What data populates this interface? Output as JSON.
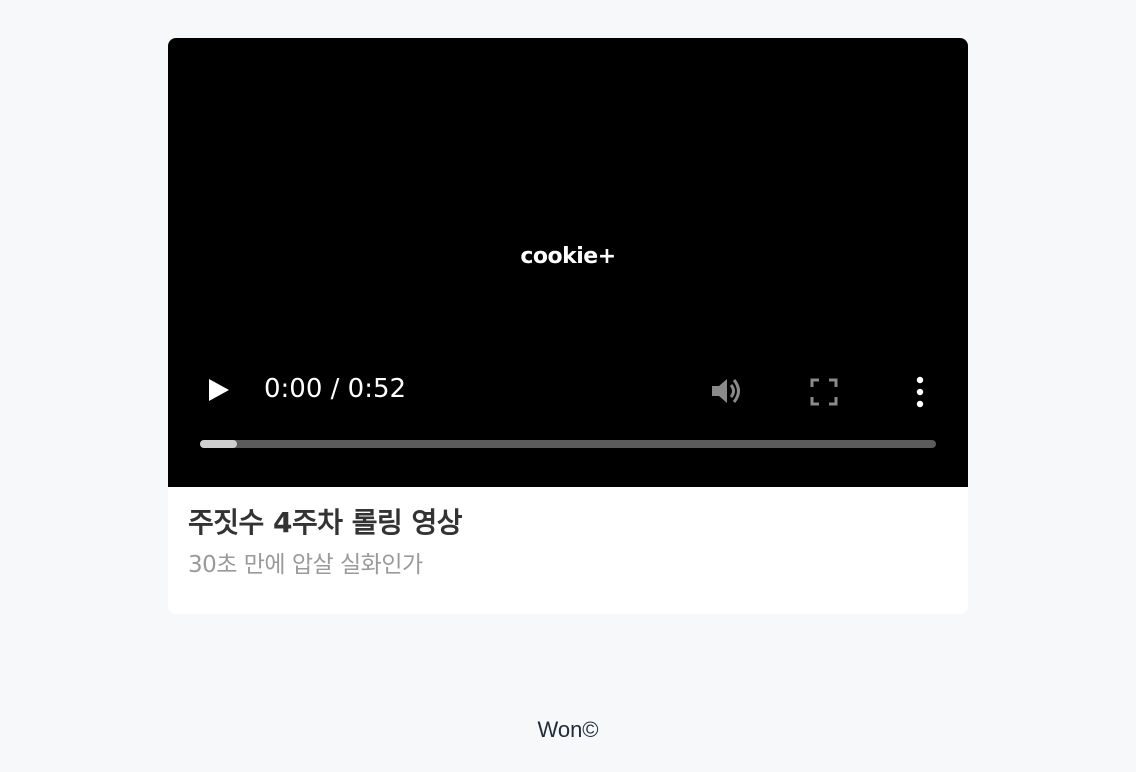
{
  "video": {
    "logo_text": "cookie+",
    "time_display": "0:00 / 0:52",
    "progress_fraction": 0.05,
    "controls": {
      "play_icon": "play-icon",
      "volume_icon": "volume-icon",
      "fullscreen_icon": "fullscreen-icon",
      "more_icon": "more-vertical-icon"
    }
  },
  "card": {
    "title": "주짓수 4주차 롤링 영상",
    "subtitle": "30초 만에 압살 실화인가"
  },
  "footer": {
    "text": "Won©"
  },
  "colors": {
    "page_background": "#f7f8fa",
    "video_background": "#000000",
    "title_text": "#333333",
    "subtitle_text": "#9a9a9a",
    "footer_text": "#222b3a"
  }
}
